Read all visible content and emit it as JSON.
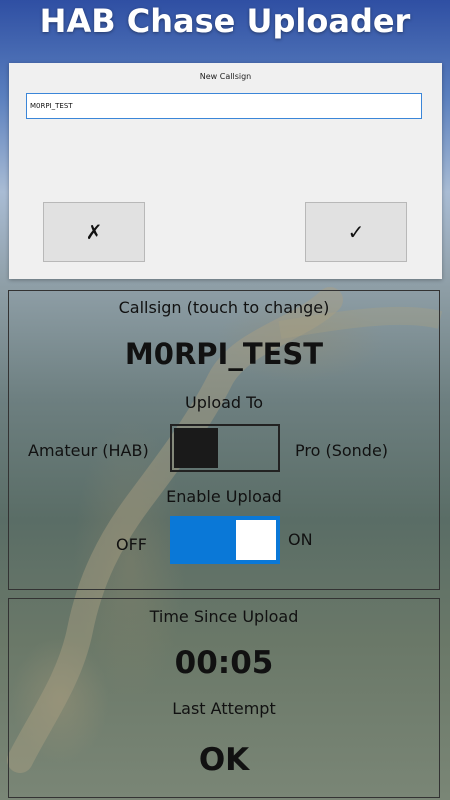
{
  "app": {
    "title": "HAB Chase Uploader"
  },
  "dialog": {
    "title": "New Callsign",
    "input_value": "M0RPI_TEST",
    "cancel_label": "✗",
    "ok_label": "✓"
  },
  "callsign": {
    "label": "Callsign (touch to change)",
    "value": "M0RPI_TEST"
  },
  "upload_to": {
    "label": "Upload To",
    "left_option": "Amateur (HAB)",
    "right_option": "Pro (Sonde)",
    "selected": "Amateur (HAB)"
  },
  "enable_upload": {
    "label": "Enable Upload",
    "off_label": "OFF",
    "on_label": "ON",
    "state": "ON"
  },
  "status": {
    "time_label": "Time Since Upload",
    "time_value": "00:05",
    "last_label": "Last Attempt",
    "last_value": "OK"
  },
  "colors": {
    "accent": "#0a78d7",
    "dialog_bg": "#f0f0f0"
  }
}
